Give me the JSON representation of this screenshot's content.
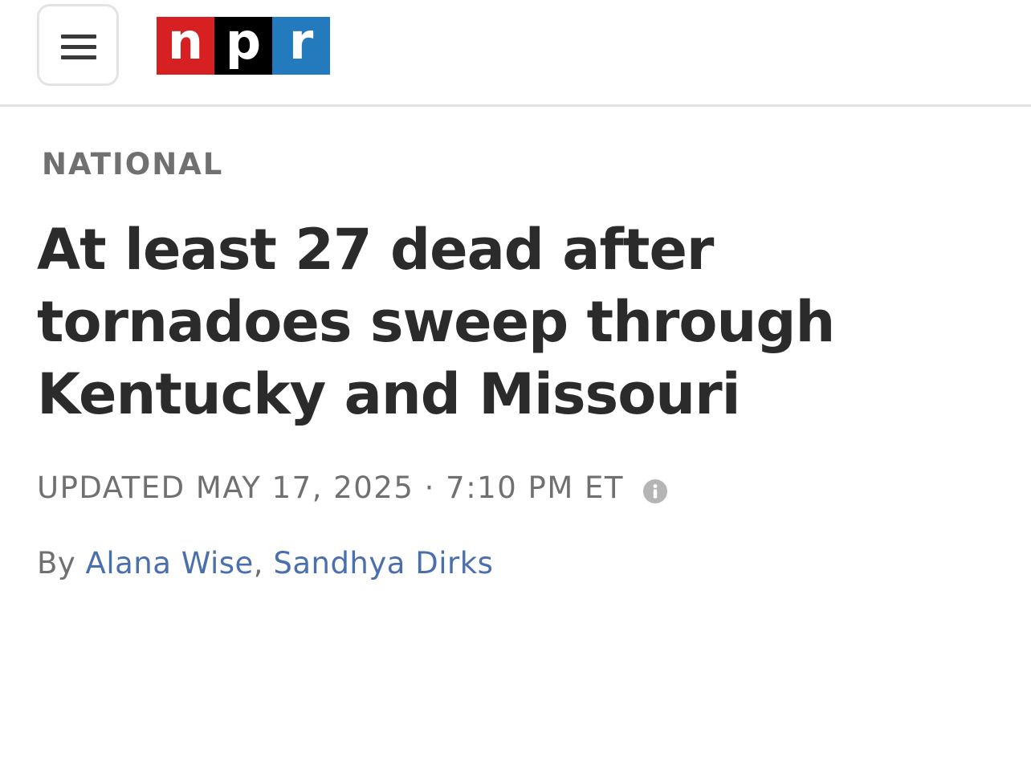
{
  "header": {
    "menu_icon": "hamburger-menu-icon",
    "logo": {
      "letters": [
        "n",
        "p",
        "r"
      ],
      "colors": [
        "#d62021",
        "#000000",
        "#237bbd"
      ]
    }
  },
  "article": {
    "section": "NATIONAL",
    "headline": "At least 27 dead after tornadoes sweep through Kentucky and Missouri",
    "updated": "UPDATED MAY 17, 2025 · 7:10 PM ET",
    "info_icon": "info-icon",
    "byline": {
      "prefix": "By ",
      "authors": [
        "Alana Wise",
        "Sandhya Dirks"
      ],
      "separator": ", "
    }
  },
  "colors": {
    "headline": "#2b2b2b",
    "meta_text": "#707070",
    "link": "#4a6fae",
    "divider": "#e2e2e2"
  }
}
